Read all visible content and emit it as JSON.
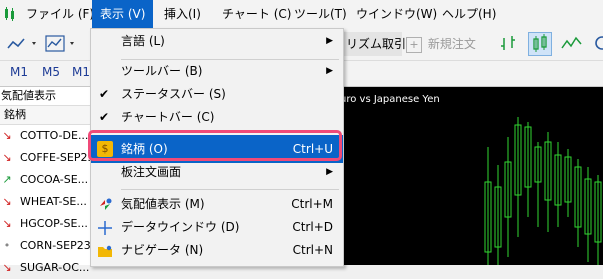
{
  "menubar": {
    "items": [
      "ファイル (F)",
      "表示 (V)",
      "挿入(I)",
      "チャート (C)",
      "ツール(T)",
      "ウインドウ(W)",
      "ヘルプ(H)"
    ]
  },
  "toolbar": {
    "algo_trading": "リズム取引",
    "new_order": "新規注文"
  },
  "timeframes": [
    "M1",
    "M5",
    "M1"
  ],
  "market_watch": {
    "title": "気配値表示",
    "column": "銘柄",
    "rows": [
      {
        "symbol": "COTTO-DE...",
        "dir": "down"
      },
      {
        "symbol": "COFFE-SEP23",
        "dir": "down"
      },
      {
        "symbol": "COCOA-SE...",
        "dir": "up"
      },
      {
        "symbol": "WHEAT-SE...",
        "dir": "down"
      },
      {
        "symbol": "HGCOP-SE...",
        "dir": "down"
      },
      {
        "symbol": "CORN-SEP23",
        "dir": "none"
      },
      {
        "symbol": "SUGAR-OC...",
        "dir": "down"
      }
    ]
  },
  "chart": {
    "title": "uro vs Japanese Yen"
  },
  "view_menu": {
    "items": [
      {
        "label": "言語 (L)",
        "submenu": true
      },
      {
        "label": "ツールバー (B)",
        "submenu": true
      },
      {
        "label": "ステータスバー (S)",
        "checked": true
      },
      {
        "label": "チャートバー (C)",
        "checked": true
      },
      {
        "label": "銘柄 (O)",
        "shortcut": "Ctrl+U",
        "highlighted": true
      },
      {
        "label": "板注文画面",
        "submenu": true
      },
      {
        "label": "気配値表示 (M)",
        "shortcut": "Ctrl+M"
      },
      {
        "label": "データウインドウ (D)",
        "shortcut": "Ctrl+D"
      },
      {
        "label": "ナビゲータ (N)",
        "shortcut": "Ctrl+N"
      }
    ]
  },
  "colors": {
    "accent": "#0a64c8",
    "highlight_frame": "#f04a78",
    "up": "#1a9a3a",
    "down": "#d02020"
  }
}
